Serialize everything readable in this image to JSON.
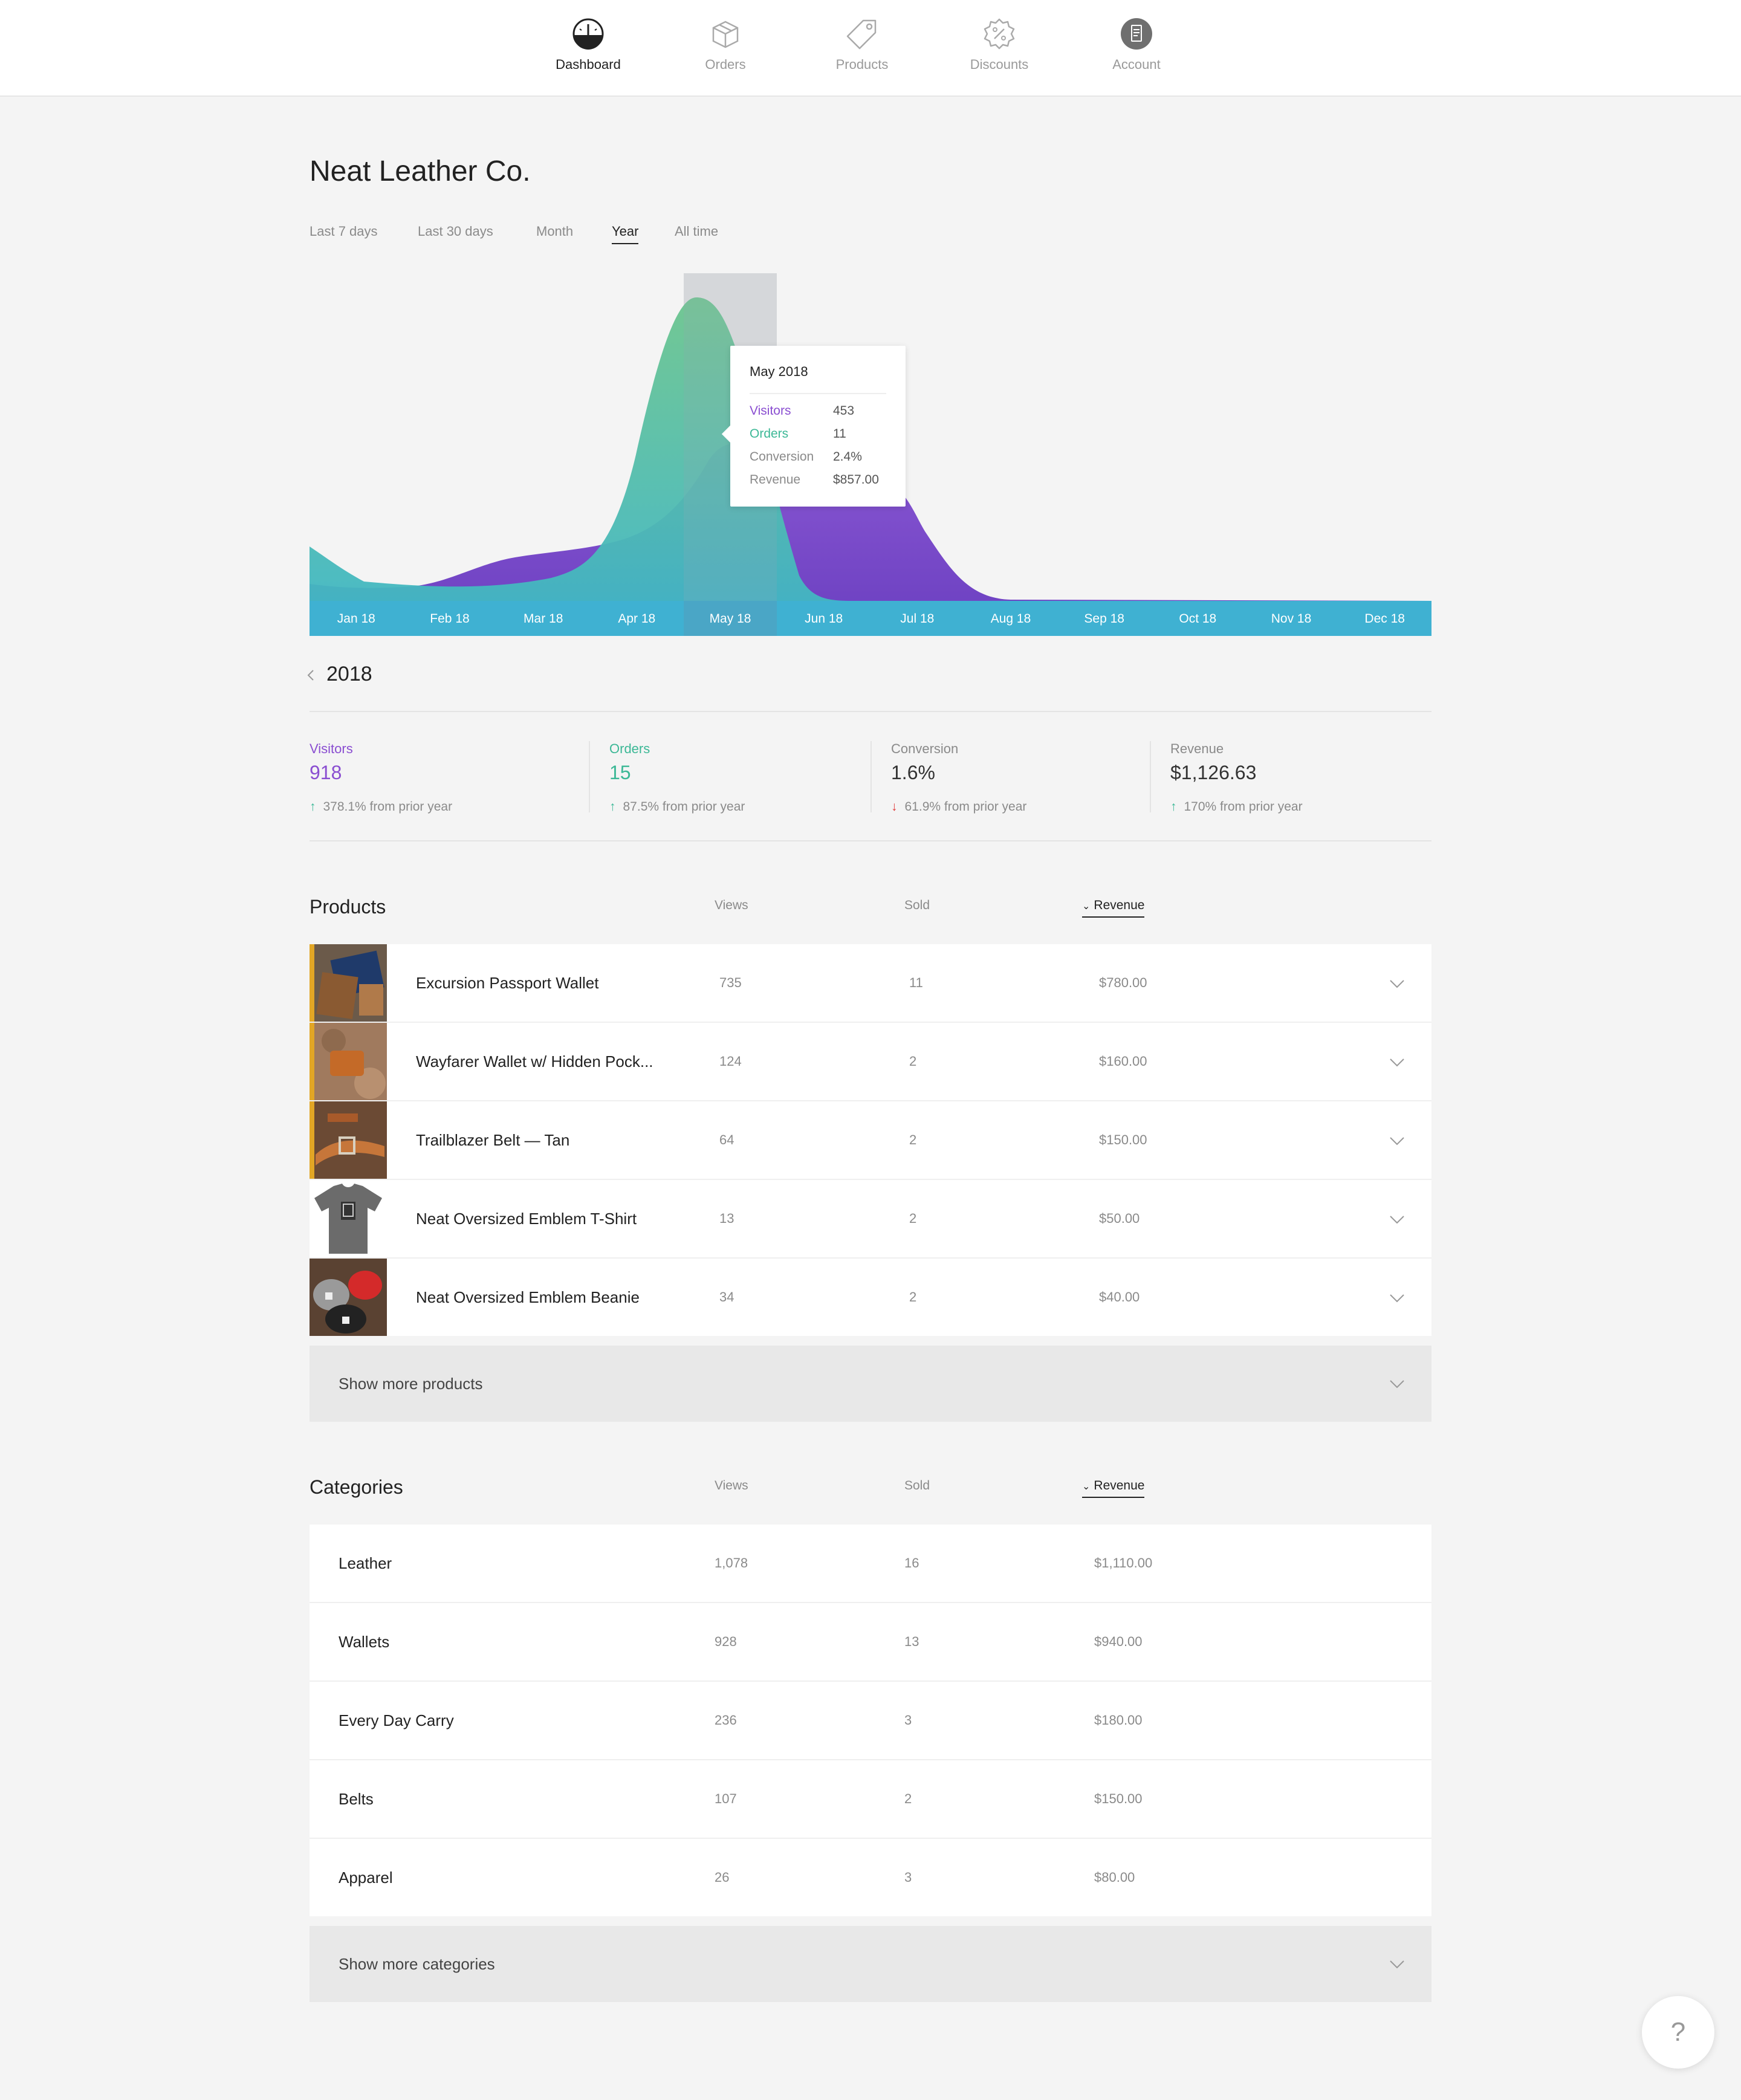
{
  "nav": {
    "items": [
      {
        "label": "Dashboard",
        "icon": "gauge-icon",
        "active": true
      },
      {
        "label": "Orders",
        "icon": "box-icon",
        "active": false
      },
      {
        "label": "Products",
        "icon": "tag-icon",
        "active": false
      },
      {
        "label": "Discounts",
        "icon": "discount-badge-icon",
        "active": false
      },
      {
        "label": "Account",
        "icon": "account-icon",
        "active": false
      }
    ]
  },
  "store": {
    "name": "Neat Leather Co."
  },
  "ranges": [
    {
      "label": "Last 7 days",
      "active": false
    },
    {
      "label": "Last 30 days",
      "active": false
    },
    {
      "label": "Month",
      "active": false
    },
    {
      "label": "Year",
      "active": true
    },
    {
      "label": "All time",
      "active": false
    }
  ],
  "chart_data": {
    "type": "area",
    "x": [
      "Jan 18",
      "Feb 18",
      "Mar 18",
      "Apr 18",
      "May 18",
      "Jun 18",
      "Jul 18",
      "Aug 18",
      "Sep 18",
      "Oct 18",
      "Nov 18",
      "Dec 18"
    ],
    "highlighted": "May 18",
    "colors": {
      "visitors": "#7c4dcc",
      "orders": "#5ec2a4",
      "axis": "#3fb1d2"
    }
  },
  "tooltip": {
    "title": "May 2018",
    "rows": [
      {
        "label": "Visitors",
        "value": "453",
        "color": "#8a4ed1"
      },
      {
        "label": "Orders",
        "value": "11",
        "color": "#3cb896"
      },
      {
        "label": "Conversion",
        "value": "2.4%",
        "color": "#8a8a8a"
      },
      {
        "label": "Revenue",
        "value": "$857.00",
        "color": "#8a8a8a"
      }
    ]
  },
  "period": {
    "year": "2018"
  },
  "stats": [
    {
      "label": "Visitors",
      "value": "918",
      "change": "378.1% from prior year",
      "direction": "up",
      "color": "#8a4ed1"
    },
    {
      "label": "Orders",
      "value": "15",
      "change": "87.5% from prior year",
      "direction": "up",
      "color": "#3cb896"
    },
    {
      "label": "Conversion",
      "value": "1.6%",
      "change": "61.9% from prior year",
      "direction": "down",
      "color": "#555555"
    },
    {
      "label": "Revenue",
      "value": "$1,126.63",
      "change": "170% from prior year",
      "direction": "up",
      "color": "#555555"
    }
  ],
  "products": {
    "title": "Products",
    "columns": {
      "views": "Views",
      "sold": "Sold",
      "revenue": "Revenue"
    },
    "rows": [
      {
        "name": "Excursion Passport Wallet",
        "views": "735",
        "sold": "11",
        "revenue": "$780.00",
        "thumb": "wallet"
      },
      {
        "name": "Wayfarer Wallet w/ Hidden Pock...",
        "views": "124",
        "sold": "2",
        "revenue": "$160.00",
        "thumb": "wallet2"
      },
      {
        "name": "Trailblazer Belt — Tan",
        "views": "64",
        "sold": "2",
        "revenue": "$150.00",
        "thumb": "belt"
      },
      {
        "name": "Neat Oversized Emblem T-Shirt",
        "views": "13",
        "sold": "2",
        "revenue": "$50.00",
        "thumb": "tshirt"
      },
      {
        "name": "Neat Oversized Emblem Beanie",
        "views": "34",
        "sold": "2",
        "revenue": "$40.00",
        "thumb": "beanie"
      }
    ],
    "show_more": "Show more products"
  },
  "categories": {
    "title": "Categories",
    "columns": {
      "views": "Views",
      "sold": "Sold",
      "revenue": "Revenue"
    },
    "rows": [
      {
        "name": "Leather",
        "views": "1,078",
        "sold": "16",
        "revenue": "$1,110.00"
      },
      {
        "name": "Wallets",
        "views": "928",
        "sold": "13",
        "revenue": "$940.00"
      },
      {
        "name": "Every Day Carry",
        "views": "236",
        "sold": "3",
        "revenue": "$180.00"
      },
      {
        "name": "Belts",
        "views": "107",
        "sold": "2",
        "revenue": "$150.00"
      },
      {
        "name": "Apparel",
        "views": "26",
        "sold": "3",
        "revenue": "$80.00"
      }
    ],
    "show_more": "Show more categories"
  },
  "help": {
    "label": "?"
  }
}
